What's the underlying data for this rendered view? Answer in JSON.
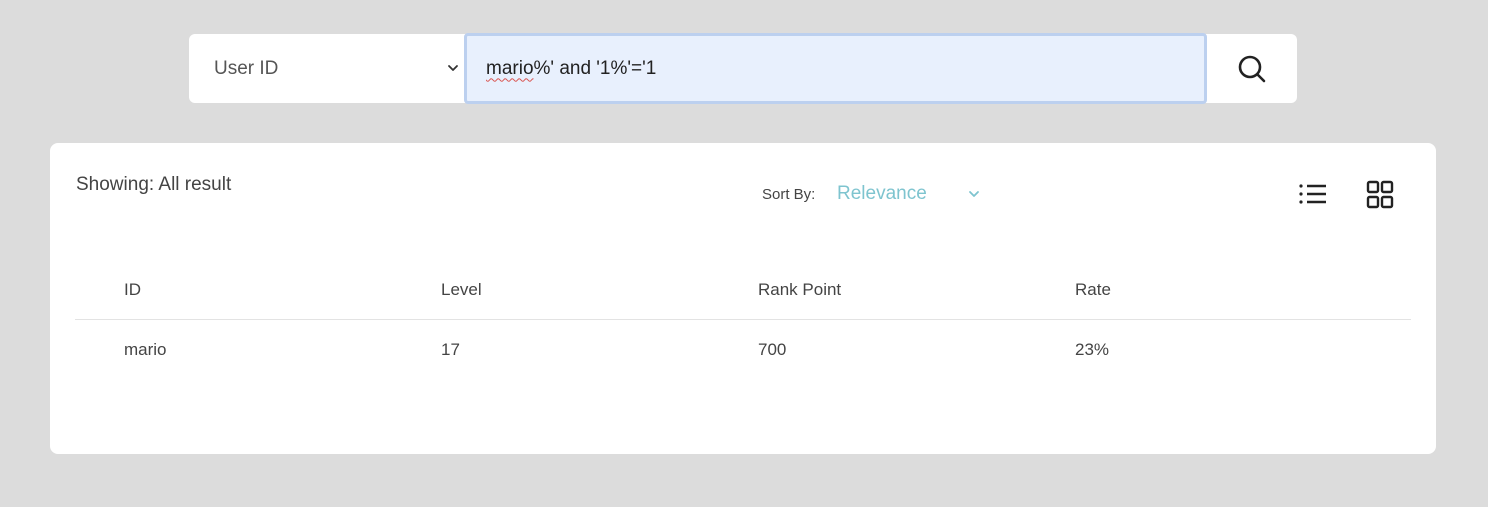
{
  "search": {
    "field_selected": "User ID",
    "query_spellflag": "mario",
    "query_rest": "%' and '1%'='1"
  },
  "results": {
    "showing_label": "Showing: All result",
    "sort_label": "Sort By:",
    "sort_value": "Relevance",
    "columns": [
      "ID",
      "Level",
      "Rank Point",
      "Rate"
    ],
    "rows": [
      [
        "mario",
        "17",
        "700",
        "23%"
      ]
    ]
  },
  "colors": {
    "background": "#dcdcdc",
    "input_focus_bg": "#e8f0fd",
    "input_focus_border": "#bcd0ef",
    "sort_accent": "#7ec4cf"
  },
  "icons": {
    "select_chevron": "chevron-down-icon",
    "search": "search-icon",
    "sort_chevron": "chevron-down-icon",
    "list_view": "list-view-icon",
    "grid_view": "grid-view-icon"
  }
}
